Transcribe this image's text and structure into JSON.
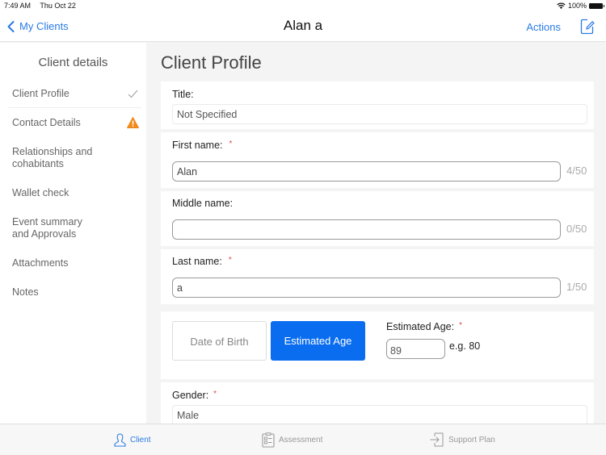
{
  "status_bar": {
    "time": "7:49 AM",
    "date": "Thu Oct 22",
    "battery": "100%",
    "icons": [
      "wifi-icon",
      "battery-icon"
    ]
  },
  "nav": {
    "back_label": "My Clients",
    "back_icon": "chevron-left-icon",
    "title": "Alan a",
    "actions_label": "Actions",
    "edit_icon": "edit-icon"
  },
  "sidebar": {
    "title": "Client details",
    "items": [
      {
        "label": "Client Profile",
        "status": "complete",
        "status_icon": "checkmark-icon",
        "check": "✓"
      },
      {
        "label": "Contact Details",
        "status": "warning",
        "status_icon": "warning-icon"
      },
      {
        "label": "Relationships and cohabitants"
      },
      {
        "label": "Wallet check"
      },
      {
        "label": "Event summary and Approvals"
      },
      {
        "label": "Attachments"
      },
      {
        "label": "Notes"
      }
    ]
  },
  "main": {
    "title": "Client Profile",
    "fields": {
      "title": {
        "label": "Title:",
        "value": "Not Specified"
      },
      "first_name": {
        "label": "First name:",
        "required": "*",
        "value": "Alan",
        "counter": "4/50"
      },
      "middle_name": {
        "label": "Middle name:",
        "value": "",
        "counter": "0/50"
      },
      "last_name": {
        "label": "Last name:",
        "required": "*",
        "value": "a",
        "counter": "1/50"
      },
      "age_mode": {
        "options": [
          "Date of Birth",
          "Estimated Age"
        ],
        "selected": "Estimated Age"
      },
      "estimated_age": {
        "label": "Estimated Age:",
        "required": "*",
        "value": "89",
        "hint": "e.g. 80"
      },
      "gender": {
        "label": "Gender:",
        "required": "*",
        "value": "Male"
      }
    }
  },
  "tab_bar": {
    "tabs": [
      {
        "label": "Client",
        "icon": "person-icon",
        "active": true
      },
      {
        "label": "Assessment",
        "icon": "clipboard-icon",
        "active": false
      },
      {
        "label": "Support Plan",
        "icon": "sign-in-icon",
        "active": false
      }
    ]
  },
  "colors": {
    "accent": "#2a7be4",
    "selected_segment": "#0a6df0",
    "warning": "#f0891c",
    "required": "#e04a4a"
  }
}
